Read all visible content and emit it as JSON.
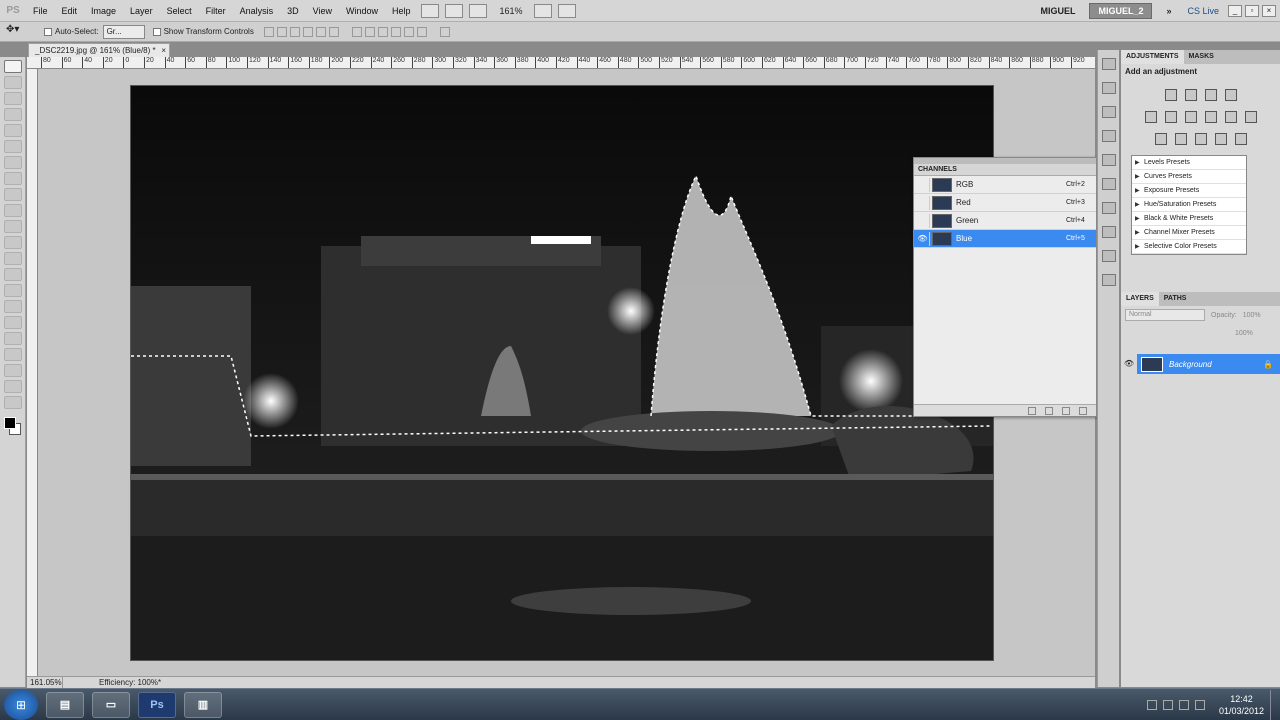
{
  "menubar": {
    "logo": "PS",
    "items": [
      "File",
      "Edit",
      "Image",
      "Layer",
      "Select",
      "Filter",
      "Analysis",
      "3D",
      "View",
      "Window",
      "Help"
    ],
    "zoom": "161%",
    "workspace_1": "MIGUEL",
    "workspace_2": "MIGUEL_2",
    "overflow": "»",
    "cs_live": "CS Live"
  },
  "options": {
    "auto_select_label": "Auto-Select:",
    "auto_select_value": "Gr...",
    "show_transform_label": "Show Transform Controls"
  },
  "document": {
    "tab_title": "_DSC2219.jpg @ 161% (Blue/8) *",
    "close": "×"
  },
  "ruler_top": [
    "80",
    "60",
    "40",
    "20",
    "0",
    "20",
    "40",
    "60",
    "80",
    "100",
    "120",
    "140",
    "160",
    "180",
    "200",
    "220",
    "240",
    "260",
    "280",
    "300",
    "320",
    "340",
    "360",
    "380",
    "400",
    "420",
    "440",
    "460",
    "480",
    "500",
    "520",
    "540",
    "560",
    "580",
    "600",
    "620",
    "640",
    "660",
    "680",
    "700",
    "720",
    "740",
    "760",
    "780",
    "800",
    "820",
    "840",
    "860",
    "880",
    "900",
    "920"
  ],
  "status": {
    "zoom": "161.05%",
    "efficiency": "Efficiency: 100%*"
  },
  "channels": {
    "title": "CHANNELS",
    "rows": [
      {
        "name": "RGB",
        "shortcut": "Ctrl+2"
      },
      {
        "name": "Red",
        "shortcut": "Ctrl+3"
      },
      {
        "name": "Green",
        "shortcut": "Ctrl+4"
      },
      {
        "name": "Blue",
        "shortcut": "Ctrl+5"
      }
    ]
  },
  "adjustments": {
    "tab_adjustments": "ADJUSTMENTS",
    "tab_masks": "MASKS",
    "subtitle": "Add an adjustment",
    "presets": [
      "Levels Presets",
      "Curves Presets",
      "Exposure Presets",
      "Hue/Saturation Presets",
      "Black & White Presets",
      "Channel Mixer Presets",
      "Selective Color Presets"
    ]
  },
  "layers": {
    "tab_layers": "LAYERS",
    "tab_paths": "PATHS",
    "blend_mode": "Normal",
    "opacity_label": "Opacity:",
    "opacity_value": "100%",
    "fill_value": "100%",
    "layer_name": "Background"
  },
  "taskbar": {
    "ps_label": "Ps",
    "time": "12:42",
    "date": "01/03/2012"
  },
  "colors": {
    "selection_blue": "#3b8af0",
    "panel_bg": "#d9d9d9"
  }
}
